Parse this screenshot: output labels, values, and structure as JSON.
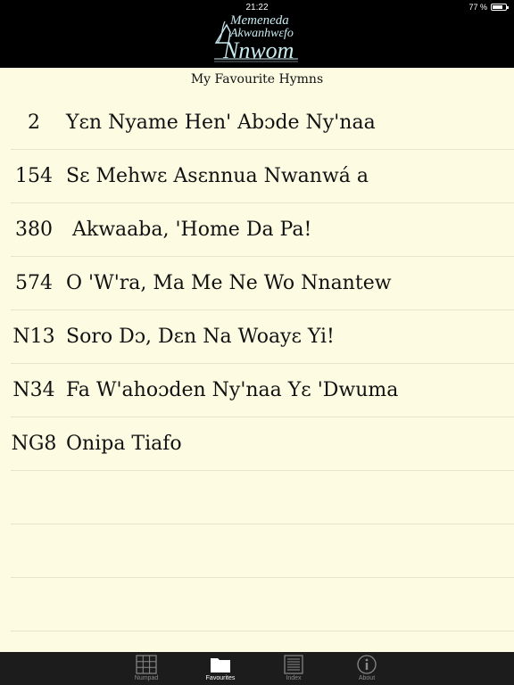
{
  "status": {
    "time": "21:22",
    "battery": "77 %",
    "battery_level": 0.77
  },
  "logo": {
    "line1": "Memeneda",
    "line2": "Akwanhwɛfo",
    "line3": "Nnwom"
  },
  "page": {
    "subtitle": "My Favourite Hymns"
  },
  "favourites": [
    {
      "number": "2",
      "title": "Yɛn Nyame Hen' Abɔde Ny'naa"
    },
    {
      "number": "154",
      "title": "Sɛ Mehwɛ Asɛnnua Nwanwá a"
    },
    {
      "number": "380",
      "title": " Akwaaba, 'Home Da Pa!"
    },
    {
      "number": "574",
      "title": "O 'W'ra, Ma Me Ne Wo Nnantew"
    },
    {
      "number": "N13",
      "title": "Soro Dɔ, Dɛn Na Woayɛ Yi!"
    },
    {
      "number": "N34",
      "title": "Fa W'ahoɔden Ny'naa Yɛ 'Dwuma"
    },
    {
      "number": "NG8",
      "title": "Onipa Tiafo"
    }
  ],
  "tabs": [
    {
      "label": "Numpad",
      "icon": "numpad-icon",
      "active": false
    },
    {
      "label": "Favourites",
      "icon": "folder-icon",
      "active": true
    },
    {
      "label": "Index",
      "icon": "index-icon",
      "active": false
    },
    {
      "label": "About",
      "icon": "info-icon",
      "active": false
    }
  ],
  "colors": {
    "background": "#fdfce2",
    "header": "#000000",
    "tabbar": "#1c1c1c",
    "logo": "#c8eaf0"
  }
}
